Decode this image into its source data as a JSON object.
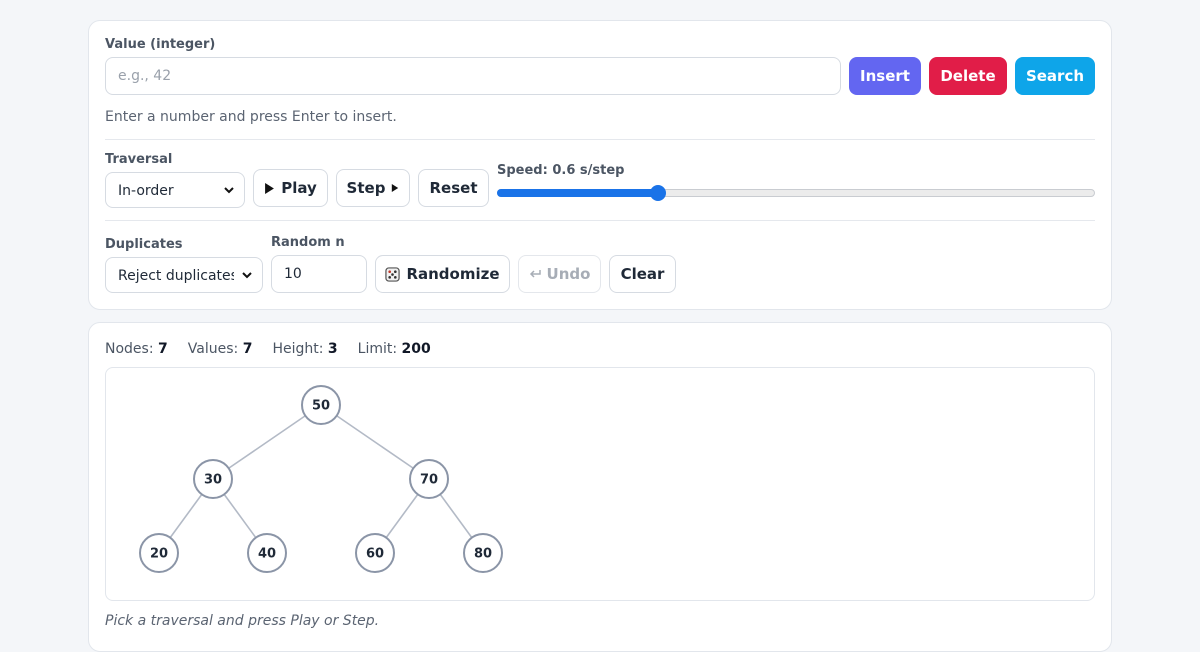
{
  "value_section": {
    "label": "Value (integer)",
    "placeholder": "e.g., 42",
    "hint": "Enter a number and press Enter to insert."
  },
  "buttons": {
    "insert": "Insert",
    "delete": "Delete",
    "search": "Search",
    "play": "Play",
    "step": "Step",
    "reset": "Reset",
    "randomize": "Randomize",
    "undo": "Undo",
    "clear": "Clear"
  },
  "traversal": {
    "label": "Traversal",
    "selected": "In-order"
  },
  "speed": {
    "label": "Speed: 0.6 s/step",
    "fraction": 0.27
  },
  "duplicates": {
    "label": "Duplicates",
    "selected": "Reject duplicates"
  },
  "random_n": {
    "label": "Random n",
    "value": "10"
  },
  "stats": {
    "nodes_label": "Nodes:",
    "nodes": "7",
    "values_label": "Values:",
    "values": "7",
    "height_label": "Height:",
    "height": "3",
    "limit_label": "Limit:",
    "limit": "200"
  },
  "tree": {
    "nodes": [
      {
        "id": "n50",
        "value": "50",
        "parent": null,
        "depth": 0,
        "slot": 0
      },
      {
        "id": "n30",
        "value": "30",
        "parent": "n50",
        "depth": 1,
        "slot": 0
      },
      {
        "id": "n70",
        "value": "70",
        "parent": "n50",
        "depth": 1,
        "slot": 1
      },
      {
        "id": "n20",
        "value": "20",
        "parent": "n30",
        "depth": 2,
        "slot": 0
      },
      {
        "id": "n40",
        "value": "40",
        "parent": "n30",
        "depth": 2,
        "slot": 1
      },
      {
        "id": "n60",
        "value": "60",
        "parent": "n70",
        "depth": 2,
        "slot": 2
      },
      {
        "id": "n80",
        "value": "80",
        "parent": "n70",
        "depth": 2,
        "slot": 3
      }
    ]
  },
  "status": "Pick a traversal and press Play or Step.",
  "colors": {
    "insert": "#6366f1",
    "delete": "#e11d48",
    "search": "#0ea5e9",
    "node_border": "#8b95a7",
    "edge": "#b3bac6",
    "slider": "#1a73e8"
  }
}
